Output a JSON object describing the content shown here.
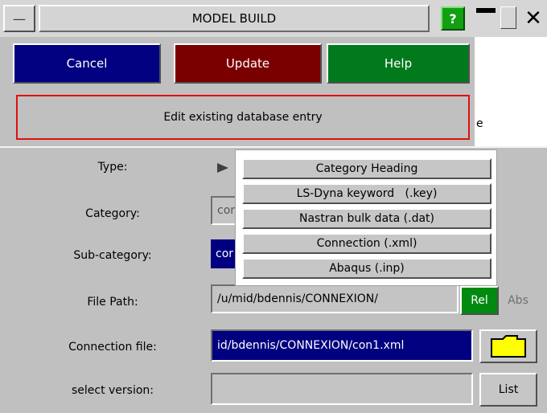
{
  "window": {
    "title": "MODEL BUILD",
    "help_glyph": "?",
    "minimize_glyph": "—",
    "close_glyph": "✕",
    "menu_glyph": "—"
  },
  "buttons": {
    "cancel": "Cancel",
    "update": "Update",
    "help": "Help",
    "colors": {
      "cancel": "#000080",
      "update": "#7a0000",
      "help": "#007a1c"
    }
  },
  "banner": {
    "text": "Edit existing database entry",
    "outside_char": "e"
  },
  "form": {
    "type_label": "Type:",
    "category_label": "Category:",
    "category_value": "cor",
    "subcategory_label": "Sub-category:",
    "subcategory_value": "cor",
    "filepath_label": "File Path:",
    "filepath_value": "/u/mid/bdennis/CONNEXION/",
    "rel_label": "Rel",
    "abs_label": "Abs",
    "connection_label": "Connection file:",
    "connection_value": "id/bdennis/CONNEXION/con1.xml",
    "version_label": "select version:",
    "version_value": "",
    "list_label": "List"
  },
  "dropdown": {
    "items": [
      "Category Heading",
      "LS-Dyna keyword   (.key)",
      "Nastran bulk data (.dat)",
      "Connection (.xml)",
      "Abaqus (.inp)"
    ]
  }
}
